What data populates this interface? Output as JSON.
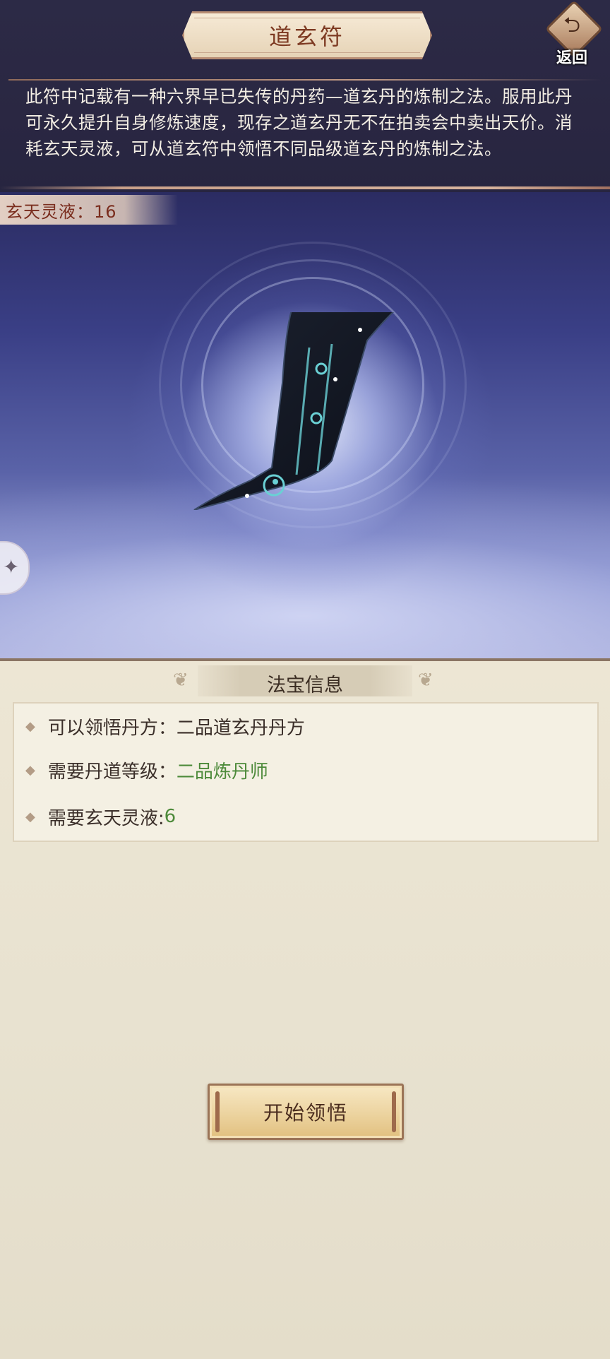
{
  "header": {
    "title": "道玄符",
    "back_label": "返回"
  },
  "description": "此符中记载有一种六界早已失传的丹药—道玄丹的炼制之法。服用此丹可永久提升自身修炼速度，现存之道玄丹无不在拍卖会中卖出天价。消耗玄天灵液，可从道玄符中领悟不同品级道玄丹的炼制之法。",
  "resource": {
    "label": "玄天灵液：16"
  },
  "info": {
    "title": "法宝信息",
    "rows": [
      {
        "label": "可以领悟丹方：",
        "value": "二品道玄丹丹方"
      },
      {
        "label": "需要丹道等级：",
        "value": "二品炼丹师"
      },
      {
        "label": "需要玄天灵液:",
        "value": "6"
      }
    ]
  },
  "start_button": {
    "label": "开始领悟"
  },
  "colors": {
    "header_bg": "#2b2843",
    "title_text": "#7d3a22",
    "value_green": "#4d8a3a",
    "panel_bg": "#e9e3d3"
  },
  "icons": [
    "back-arrow-icon",
    "diamond-bullet-icon",
    "talisman-scroll-icon",
    "puzzle-tab-icon"
  ]
}
